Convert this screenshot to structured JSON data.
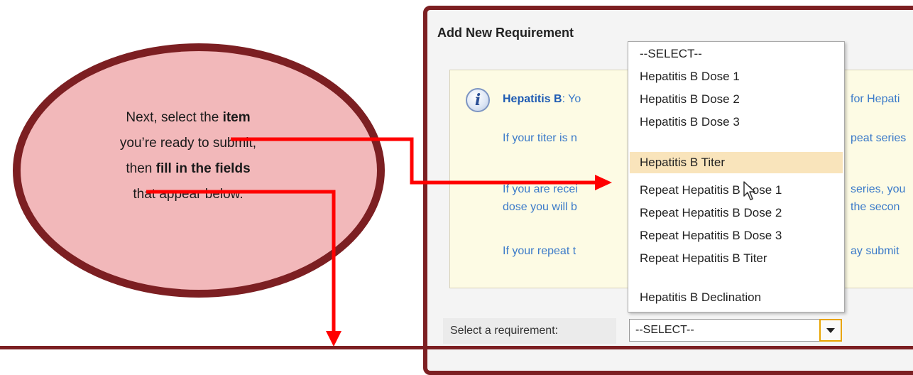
{
  "callout": {
    "line1_pre": "Next, select the ",
    "line1_bold": "item",
    "line2": "you’re ready to submit,",
    "line3_pre": "then ",
    "line3_bold": "fill in the fields",
    "line4": "that appear below."
  },
  "panel": {
    "title": "Add  New  Requirement",
    "info": {
      "line1_bold": "Hepatitis B",
      "line1_a": ": Yo",
      "line1_b": "for Hepati",
      "line2_a": "If your titer is n",
      "line2_b": "peat series",
      "line3_a": "If you are recei",
      "line3_b": "series, you",
      "line4_a": "dose you will b",
      "line4_b": "the secon",
      "line5_a": "If your repeat t",
      "line5_b": "ay submit"
    },
    "requirement_label": "Select a requirement:",
    "select_value": "--SELECT--"
  },
  "dropdown": {
    "options": [
      "--SELECT--",
      "Hepatitis B Dose 1",
      "Hepatitis B Dose 2",
      "Hepatitis B Dose 3",
      "Hepatitis B Titer",
      "Repeat Hepatitis B Dose 1",
      "Repeat Hepatitis B Dose 2",
      "Repeat Hepatitis B Dose 3",
      "Repeat Hepatitis B Titer",
      "Hepatitis B Declination"
    ],
    "highlighted": "Hepatitis B Titer"
  },
  "colors": {
    "accent": "#7c1f22",
    "arrow": "#ff0000",
    "callout_fill": "#f2b8ba",
    "highlight": "#f9e4bb",
    "info_text": "#3b7ac9"
  },
  "icons": [
    "info-icon",
    "mouse-cursor-icon",
    "dropdown-arrow-icon"
  ]
}
